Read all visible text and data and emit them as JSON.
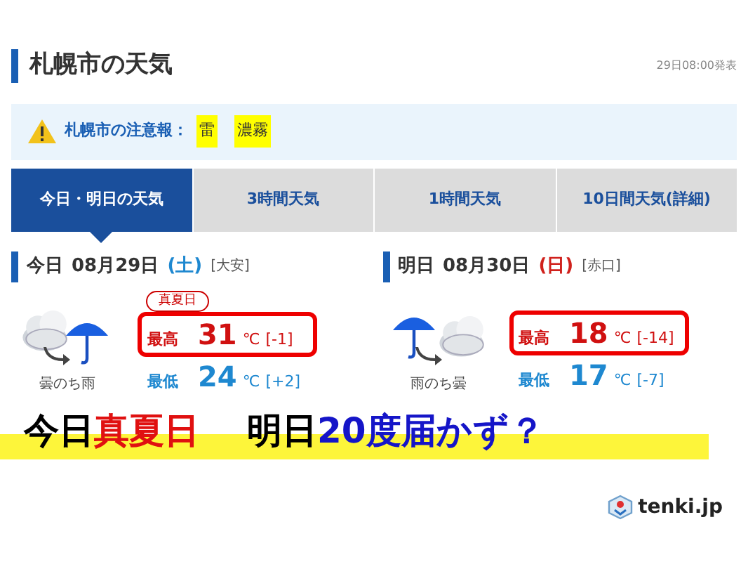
{
  "header": {
    "title": "札幌市の天気",
    "issued": "29日08:00発表"
  },
  "advisory": {
    "label": "札幌市の注意報：",
    "items": [
      "雷",
      "濃霧"
    ]
  },
  "tabs": [
    {
      "label": "今日・明日の天気",
      "selected": true
    },
    {
      "label": "3時間天気",
      "selected": false
    },
    {
      "label": "1時間天気",
      "selected": false
    },
    {
      "label": "10日間天気(詳細)",
      "selected": false
    }
  ],
  "days": [
    {
      "day": "今日",
      "date": "08月29日",
      "weekday": "(土)",
      "color": "#1e88d0",
      "rokuyo": "[大安]",
      "weather": "曇のち雨",
      "icon": [
        {
          "kind": "cloud"
        },
        {
          "kind": "rain"
        }
      ],
      "badge": "真夏日",
      "high": {
        "label": "最高",
        "value": "31",
        "unit": "℃",
        "diff": "[-1]"
      },
      "low": {
        "label": "最低",
        "value": "24",
        "unit": "℃",
        "diff": "[+2]"
      }
    },
    {
      "day": "明日",
      "date": "08月30日",
      "weekday": "(日)",
      "color": "#d0211c",
      "rokuyo": "[赤口]",
      "weather": "雨のち曇",
      "icon": [
        {
          "kind": "rain"
        },
        {
          "kind": "cloud"
        }
      ],
      "high": {
        "label": "最高",
        "value": "18",
        "unit": "℃",
        "diff": "[-14]"
      },
      "low": {
        "label": "最低",
        "value": "17",
        "unit": "℃",
        "diff": "[-7]"
      }
    }
  ],
  "caption": [
    {
      "text": "今日",
      "color": "#000000"
    },
    {
      "text": "真夏日",
      "color": "#e01010"
    },
    {
      "text": "明日",
      "color": "#000000"
    },
    {
      "text": "20度届かず？",
      "color": "#1515c8"
    }
  ],
  "logo": {
    "text": "tenki.jp"
  }
}
